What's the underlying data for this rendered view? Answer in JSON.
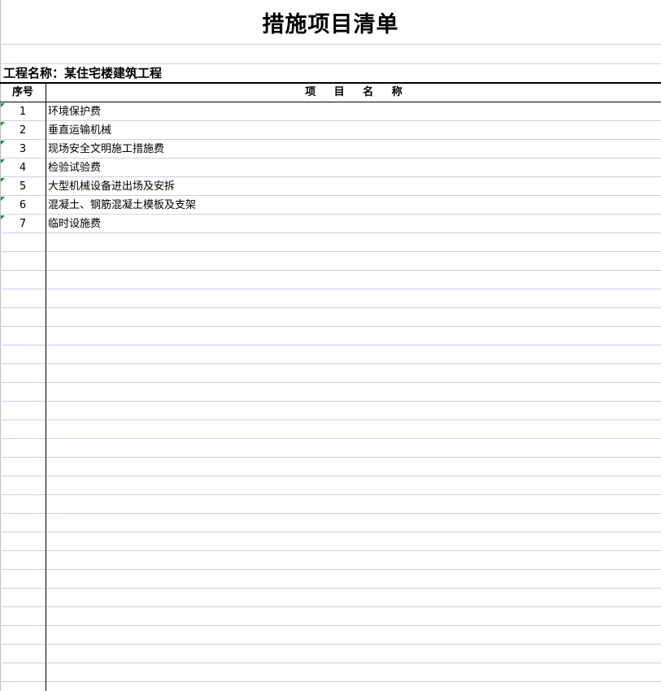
{
  "title": "措施项目清单",
  "project": {
    "label": "工程名称：",
    "name": "某住宅楼建筑工程"
  },
  "table": {
    "headers": {
      "seq": "序号",
      "name": "项 目 名 称"
    },
    "rows": [
      {
        "seq": "1",
        "name": "环境保护费"
      },
      {
        "seq": "2",
        "name": "垂直运输机械"
      },
      {
        "seq": "3",
        "name": "现场安全文明施工措施费"
      },
      {
        "seq": "4",
        "name": "检验试验费"
      },
      {
        "seq": "5",
        "name": "大型机械设备进出场及安拆"
      },
      {
        "seq": "6",
        "name": "混凝土、钢筋混凝土模板及支架"
      },
      {
        "seq": "7",
        "name": "临时设施费"
      }
    ]
  },
  "colors": {
    "gridline": "#cfcfe6",
    "border": "#000000",
    "cell_marker": "#1f8a2a"
  }
}
